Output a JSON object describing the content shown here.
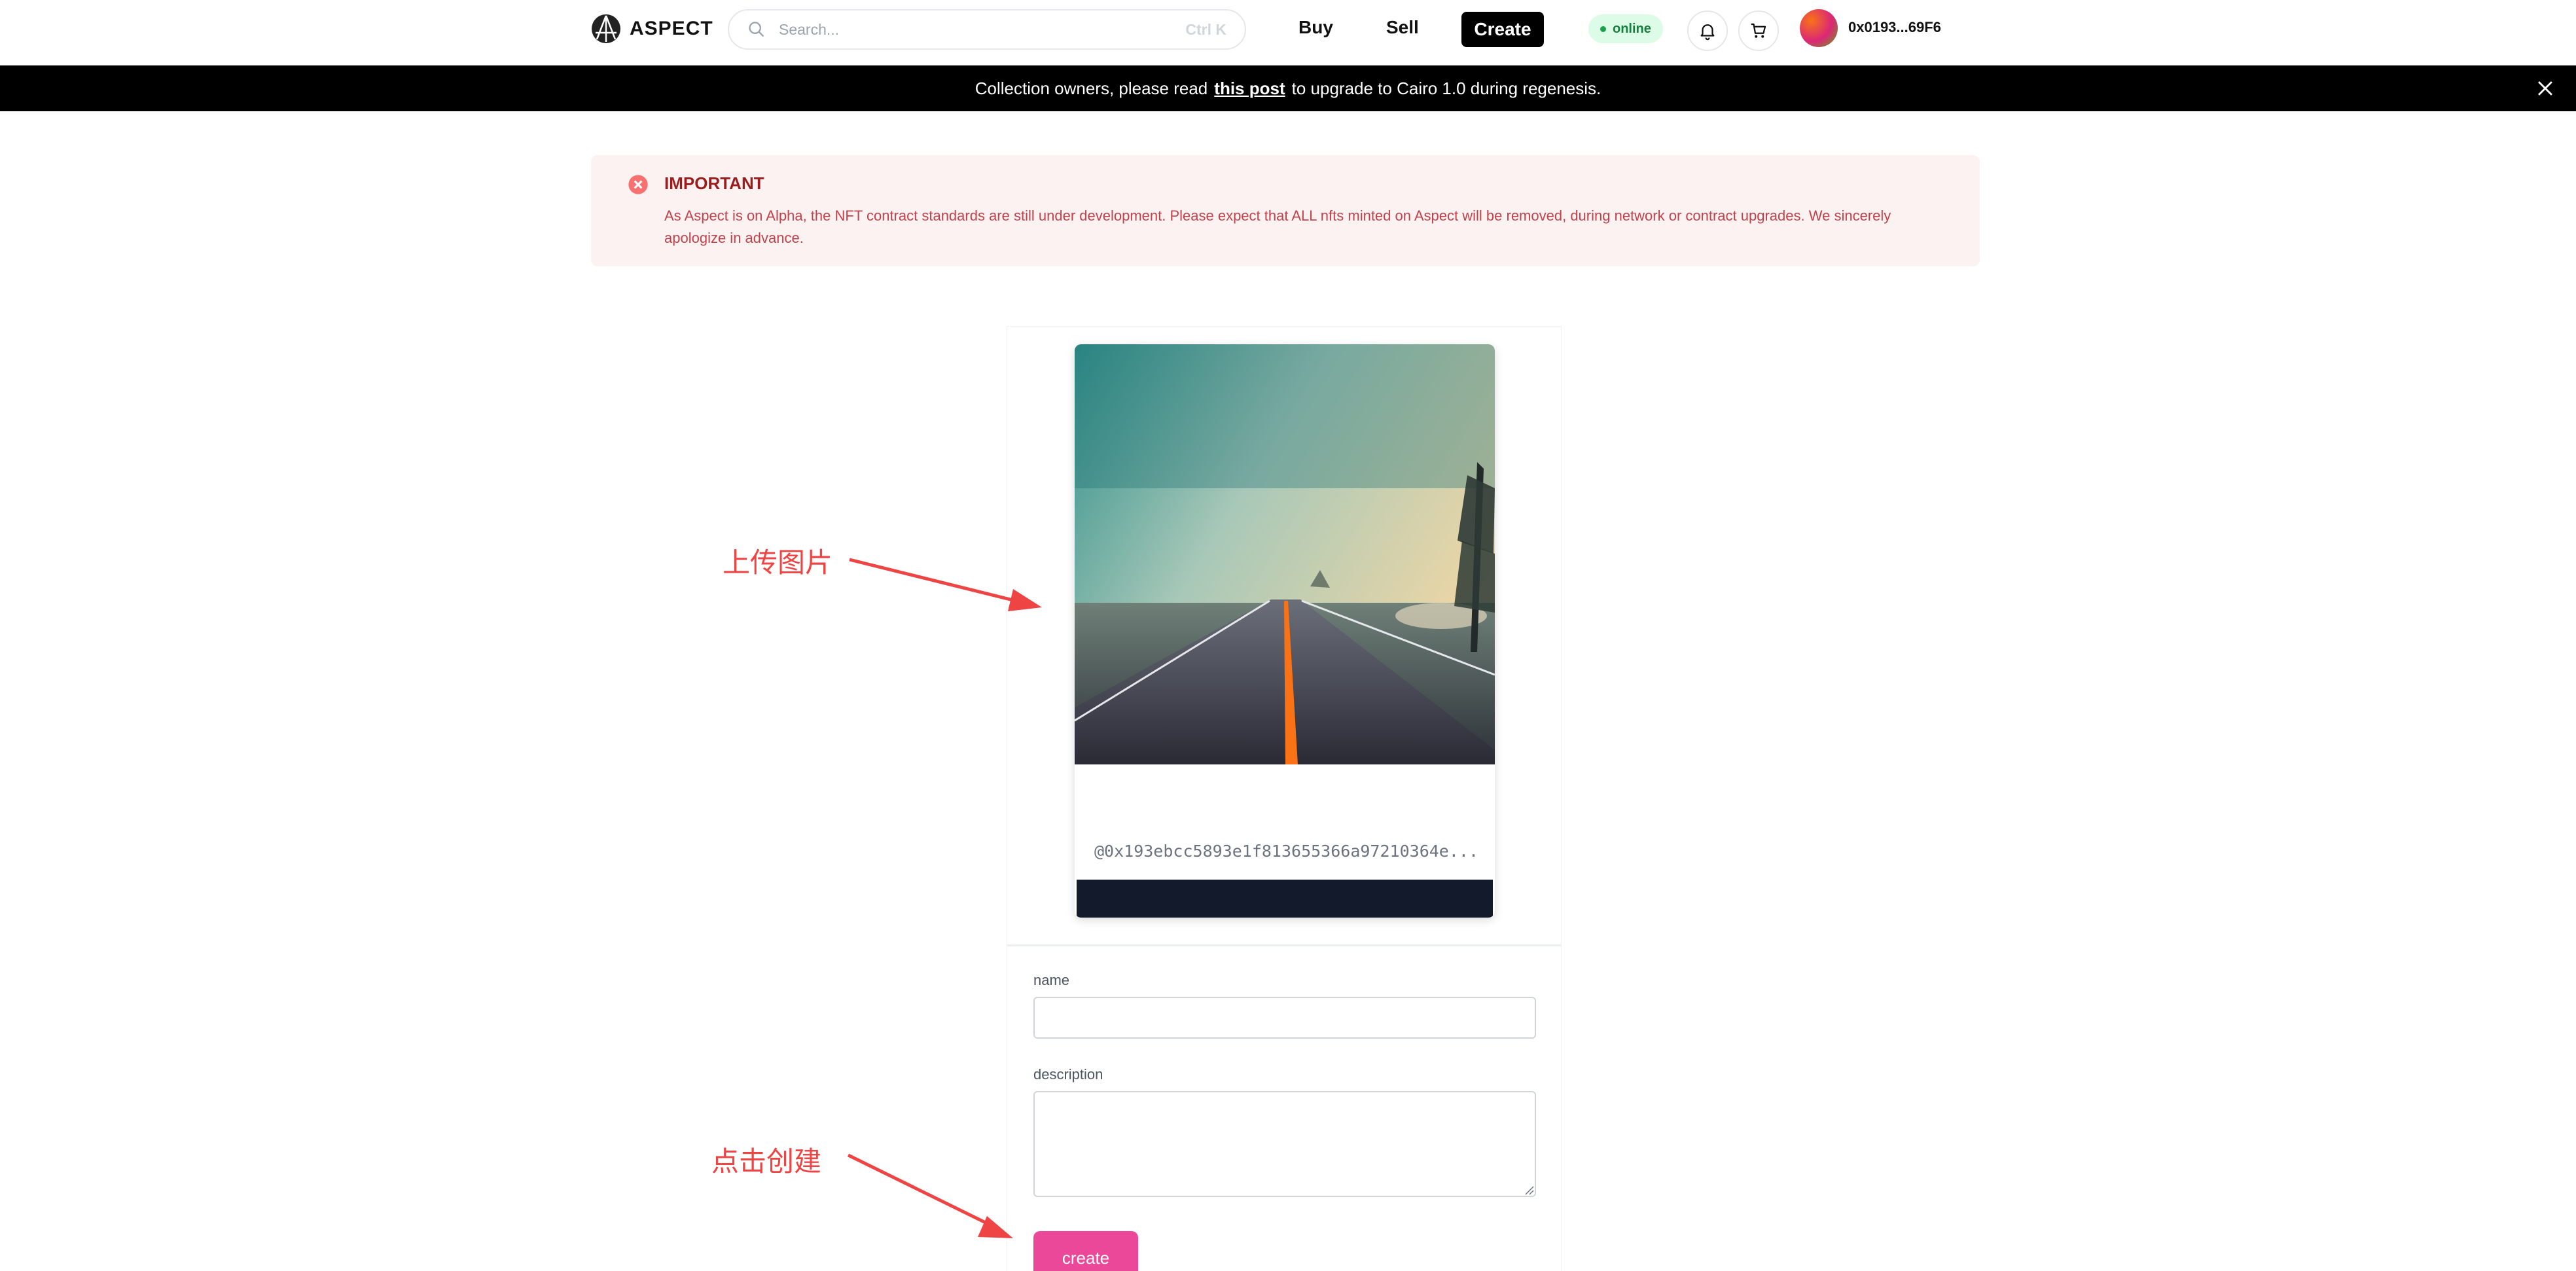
{
  "nav": {
    "brand": "ASPECT",
    "search_placeholder": "Search...",
    "search_shortcut": "Ctrl K",
    "buy": "Buy",
    "sell": "Sell",
    "create": "Create",
    "status": "online",
    "address": "0x0193...69F6",
    "icons": [
      "bell-icon",
      "cart-icon",
      "search-icon"
    ]
  },
  "banner": {
    "prefix": "Collection owners, please read",
    "link": "this post",
    "suffix": "to upgrade to Cairo 1.0 during regenesis."
  },
  "alert": {
    "title": "IMPORTANT",
    "body": "As Aspect is on Alpha, the NFT contract standards are still under development. Please expect that ALL nfts minted on Aspect will be removed, during network or contract upgrades. We sincerely apologize in advance."
  },
  "preview": {
    "owner": "@0x193ebcc5893e1f813655366a97210364e..."
  },
  "form": {
    "name_label": "name",
    "description_label": "description",
    "name_value": "",
    "description_value": "",
    "submit": "create"
  },
  "annotations": {
    "upload": "上传图片",
    "click_create": "点击创建"
  },
  "colors": {
    "accent": "#ec4899",
    "alert_bg": "#fdf2f2",
    "alert_text": "#c2414a",
    "annotation": "#ef4444",
    "status_bg": "#dcfce7"
  }
}
